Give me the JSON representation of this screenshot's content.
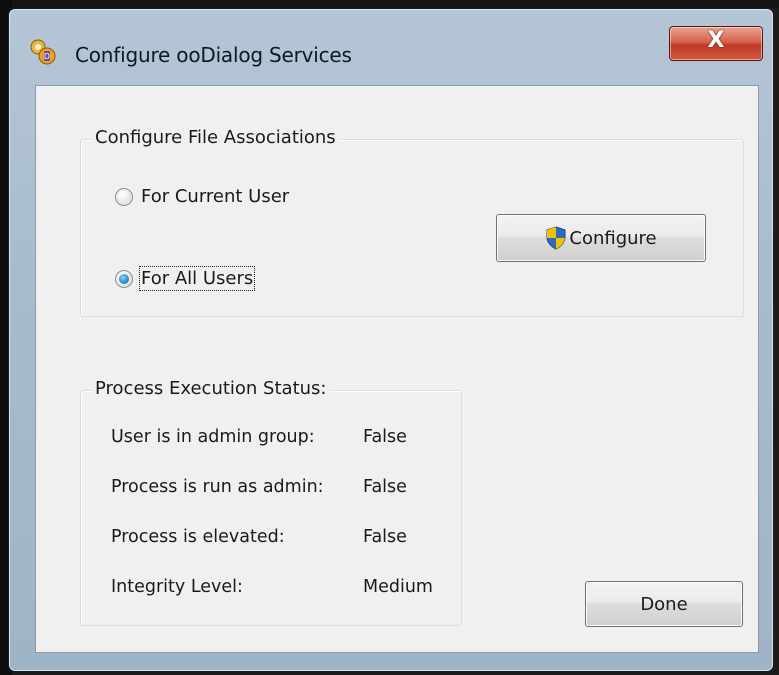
{
  "window": {
    "title": "Configure ooDialog Services",
    "close_label": "X"
  },
  "file_assoc": {
    "title": "Configure File Associations",
    "options": [
      {
        "label": "For Current User",
        "checked": false
      },
      {
        "label": "For All Users",
        "checked": true
      }
    ],
    "configure_label": "Configure"
  },
  "status": {
    "title": "Process Execution Status:",
    "rows": [
      {
        "label": "User is in admin group:",
        "value": "False"
      },
      {
        "label": "Process is run as admin:",
        "value": "False"
      },
      {
        "label": "Process is elevated:",
        "value": "False"
      },
      {
        "label": "Integrity Level:",
        "value": "Medium"
      }
    ]
  },
  "done_label": "Done",
  "colors": {
    "close_button": "#c1392a",
    "radio_checked": "#2b8fd6",
    "shield_blue": "#2a6cc4",
    "shield_yellow": "#f2c200"
  }
}
